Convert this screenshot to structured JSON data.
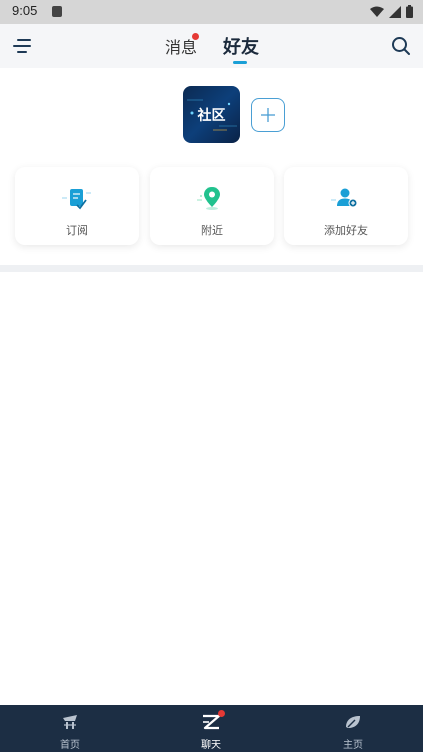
{
  "status_bar": {
    "time": "9:05"
  },
  "header": {
    "tabs": [
      {
        "label": "消息",
        "has_badge": true
      },
      {
        "label": "好友",
        "active": true
      }
    ]
  },
  "community": {
    "tile_label": "社区"
  },
  "quick_actions": [
    {
      "label": "订阅",
      "icon": "subscribe-icon"
    },
    {
      "label": "附近",
      "icon": "location-pin-icon"
    },
    {
      "label": "添加好友",
      "icon": "add-friend-icon"
    }
  ],
  "bottom_nav": [
    {
      "label": "首页",
      "icon": "home-icon"
    },
    {
      "label": "聊天",
      "icon": "chat-icon",
      "active": true,
      "has_badge": true
    },
    {
      "label": "主页",
      "icon": "profile-icon"
    }
  ],
  "colors": {
    "accent": "#1a9fd6",
    "nav_bg": "#1c2e44",
    "badge": "#e53935"
  }
}
